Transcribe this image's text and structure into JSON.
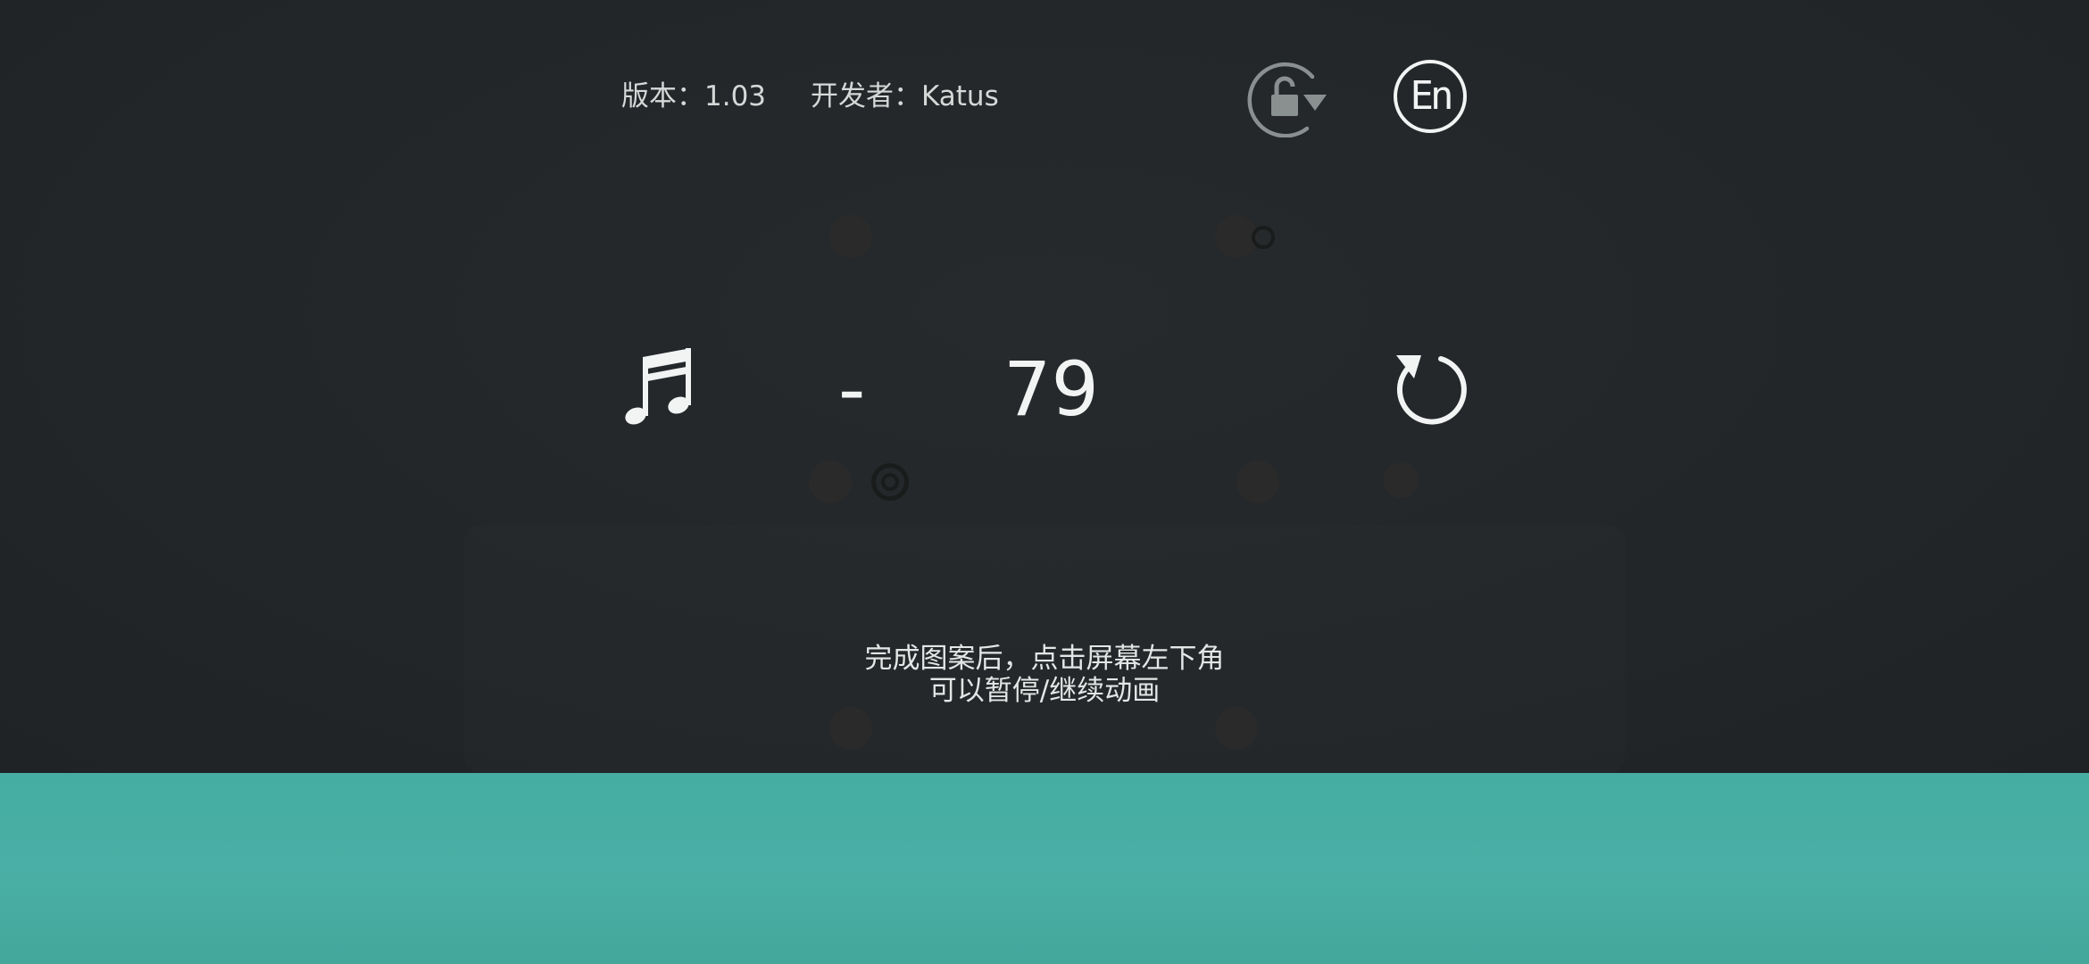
{
  "header": {
    "version_text": "版本：1.03",
    "developer_text": "开发者：Katus",
    "rotation_lock_icon": "rotation-lock-icon",
    "language_button_label": "En"
  },
  "controls": {
    "music_icon": "music-note-icon",
    "left_value": "-",
    "right_value": "79",
    "restart_icon": "restart-icon"
  },
  "hint": {
    "line1": "完成图案后，点击屏幕左下角",
    "line2": "可以暂停/继续动画"
  },
  "colors": {
    "top_background": "#222628",
    "bottom_background": "#48ada3",
    "text": "#f2f3f3",
    "icon_dim": "#8a8f90"
  }
}
